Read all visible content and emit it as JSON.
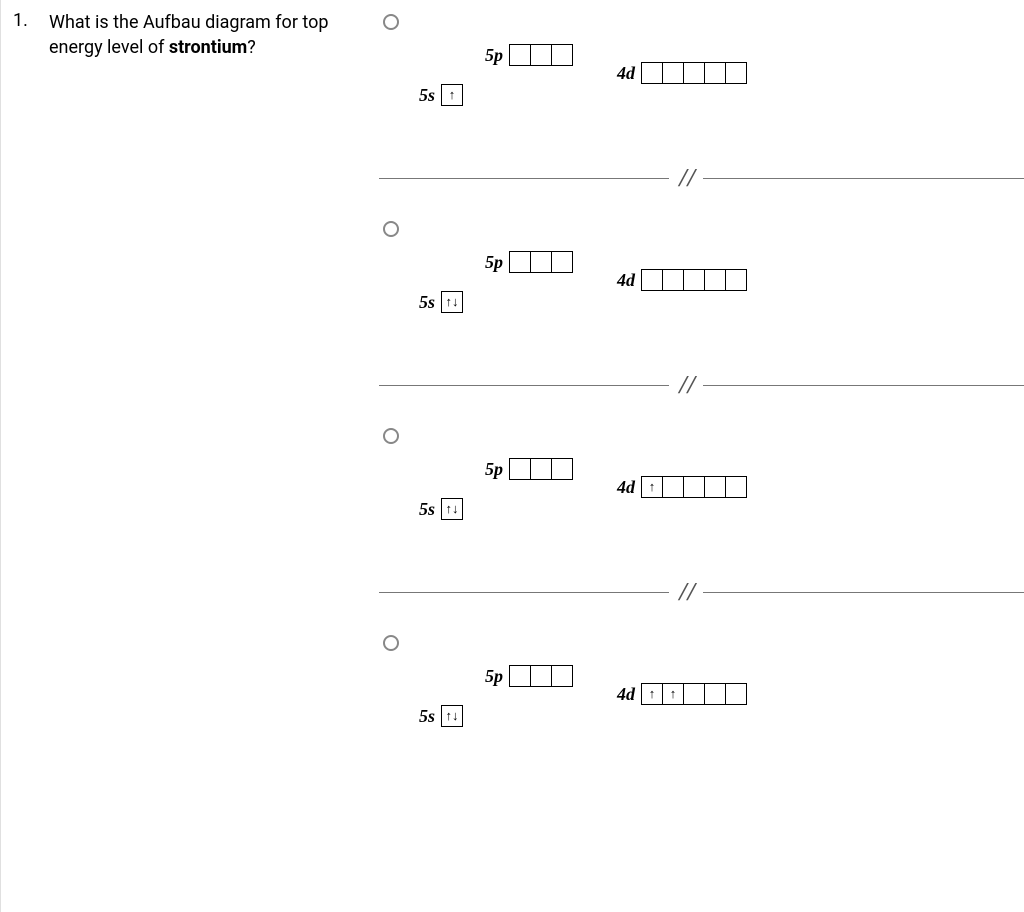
{
  "question": {
    "number": "1.",
    "text_before": "What is the Aufbau diagram for top energy level of ",
    "bold_word": "strontium",
    "text_after": "?"
  },
  "labels": {
    "s": "5s",
    "p": "5p",
    "d": "4d"
  },
  "arrows": {
    "up": "↑",
    "updown": "↑↓"
  },
  "options": [
    {
      "s": [
        "up"
      ],
      "p": [
        "",
        "",
        ""
      ],
      "d": [
        "",
        "",
        "",
        "",
        ""
      ]
    },
    {
      "s": [
        "updown"
      ],
      "p": [
        "",
        "",
        ""
      ],
      "d": [
        "",
        "",
        "",
        "",
        ""
      ]
    },
    {
      "s": [
        "updown"
      ],
      "p": [
        "",
        "",
        ""
      ],
      "d": [
        "up",
        "",
        "",
        "",
        ""
      ]
    },
    {
      "s": [
        "updown"
      ],
      "p": [
        "",
        "",
        ""
      ],
      "d": [
        "up",
        "up",
        "",
        "",
        ""
      ]
    }
  ],
  "divider_glyph": "/  /"
}
